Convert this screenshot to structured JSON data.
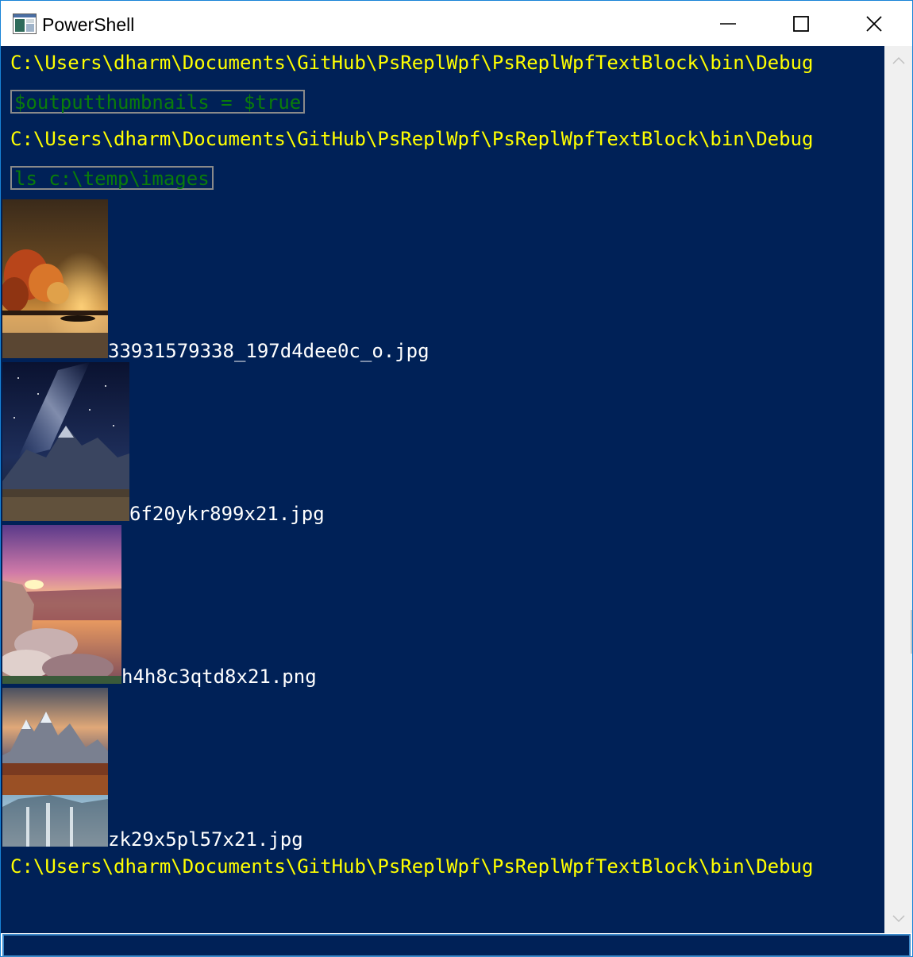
{
  "window": {
    "title": "PowerShell",
    "icon": "powershell-app-icon",
    "controls": {
      "minimize": "minimize-icon",
      "maximize": "maximize-icon",
      "close": "close-icon"
    }
  },
  "colors": {
    "console_background": "#002157",
    "prompt_text": "#ffff00",
    "command_text": "#0a7d0a",
    "output_text": "#ffffff"
  },
  "console": {
    "prompt_path": "C:\\Users\\dharm\\Documents\\GitHub\\PsReplWpf\\PsReplWpfTextBlock\\bin\\Debug",
    "entries": [
      {
        "prompt": "C:\\Users\\dharm\\Documents\\GitHub\\PsReplWpf\\PsReplWpfTextBlock\\bin\\Debug",
        "command": "$outputthumbnails = $true"
      },
      {
        "prompt": "C:\\Users\\dharm\\Documents\\GitHub\\PsReplWpf\\PsReplWpfTextBlock\\bin\\Debug",
        "command": "ls c:\\temp\\images"
      }
    ],
    "files": [
      {
        "name": "33931579338_197d4dee0c_o.jpg",
        "thumbnail": "autumn-lake-sunrise-thumbnail"
      },
      {
        "name": "6f20ykr899x21.jpg",
        "thumbnail": "milky-way-mountains-thumbnail"
      },
      {
        "name": "h4h8c3qtd8x21.png",
        "thumbnail": "canyon-sunset-thumbnail"
      },
      {
        "name": "zk29x5pl57x21.jpg",
        "thumbnail": "mountain-waterfall-thumbnail"
      }
    ],
    "final_prompt": "C:\\Users\\dharm\\Documents\\GitHub\\PsReplWpf\\PsReplWpfTextBlock\\bin\\Debug"
  },
  "input": {
    "value": ""
  }
}
